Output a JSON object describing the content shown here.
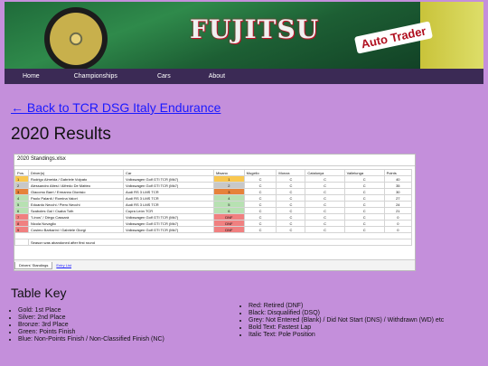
{
  "banner": {
    "sponsor": "FUJITSU",
    "sponsor2": "Auto Trader"
  },
  "nav": {
    "items": [
      "Home",
      "Championships",
      "Cars",
      "About"
    ]
  },
  "back_link": "← Back to TCR DSG Italy Endurance",
  "page_title": "2020 Results",
  "sheet": {
    "filename": "2020 Standings.xlsx",
    "headers": [
      "Pos.",
      "Driver(s)",
      "Car",
      "Misano",
      "Mugello",
      "Monza",
      "Catalunya",
      "Vallelunga",
      "Points"
    ],
    "rows": [
      {
        "pos": "1",
        "drivers": "Rodrigo Almeida / Gabriele Volpato",
        "car": "Volkswagen Golf GTI TCR (Mk7)",
        "r": [
          "1",
          "C",
          "C",
          "C",
          "C"
        ],
        "pts": "40",
        "cls": "gold"
      },
      {
        "pos": "2",
        "drivers": "Alessandro Altesi / Alfredo De Matteo",
        "car": "Volkswagen Golf GTI TCR (Mk7)",
        "r": [
          "2",
          "C",
          "C",
          "C",
          "C"
        ],
        "pts": "35",
        "cls": "silver"
      },
      {
        "pos": "3",
        "drivers": "Giacomo Barri / Ermanno Dionisio",
        "car": "Audi RS 3 LMS TCR",
        "r": [
          "3",
          "C",
          "C",
          "C",
          "C"
        ],
        "pts": "30",
        "cls": "bronze"
      },
      {
        "pos": "4",
        "drivers": "Paolo Palanti / Romina Vaiori",
        "car": "Audi RS 3 LMS TCR",
        "r": [
          "4",
          "C",
          "C",
          "C",
          "C"
        ],
        "pts": "27",
        "cls": "green"
      },
      {
        "pos": "5",
        "drivers": "Edoardo Necchi / Piero Necchi",
        "car": "Audi RS 3 LMS TCR",
        "r": [
          "5",
          "C",
          "C",
          "C",
          "C"
        ],
        "pts": "24",
        "cls": "green"
      },
      {
        "pos": "6",
        "drivers": "Szaboles Gal / Csaba Toth",
        "car": "Cupra León TCR",
        "r": [
          "6",
          "C",
          "C",
          "C",
          "C"
        ],
        "pts": "21",
        "cls": "green"
      },
      {
        "pos": "7",
        "drivers": "\"Linos\" / Diego Cassarà",
        "car": "Volkswagen Golf GTI TCR (Mk7)",
        "r": [
          "DNF",
          "C",
          "C",
          "C",
          "C"
        ],
        "pts": "0",
        "cls": "red"
      },
      {
        "pos": "8",
        "drivers": "Nicola Novaglio",
        "car": "Volkswagen Golf GTI TCR (Mk7)",
        "r": [
          "DNF",
          "C",
          "C",
          "C",
          "C"
        ],
        "pts": "0",
        "cls": "red"
      },
      {
        "pos": "9",
        "drivers": "Cosimo Barbarini / Gabriele Giorgi",
        "car": "Volkswagen Golf GTI TCR (Mk7)",
        "r": [
          "DNF",
          "C",
          "C",
          "C",
          "C"
        ],
        "pts": "0",
        "cls": "red"
      }
    ],
    "note": "Season was abandoned after first round",
    "tabs": [
      "Drivers' Standings",
      "Entry List"
    ]
  },
  "key_title": "Table Key",
  "key_left": [
    "Gold: 1st Place",
    "Silver: 2nd Place",
    "Bronze: 3rd Place",
    "Green: Points Finish",
    "Blue: Non-Points Finish / Non-Classified Finish (NC)"
  ],
  "key_right": [
    "Red: Retired (DNF)",
    "Black: Disqualified (DSQ)",
    "Grey: Not Entered (Blank) / Did Not Start (DNS) / Withdrawn (WD) etc",
    "Bold Text: Fastest Lap",
    "Italic Text: Pole Position"
  ],
  "colors": {
    "page_bg": "#c48fdb",
    "nav_bg": "#3b2a55",
    "link": "#1a1aff",
    "gold": "#f9c74f",
    "silver": "#c8c8c8",
    "bronze": "#e6823a",
    "green": "#b7e1b2",
    "red": "#f08080"
  }
}
